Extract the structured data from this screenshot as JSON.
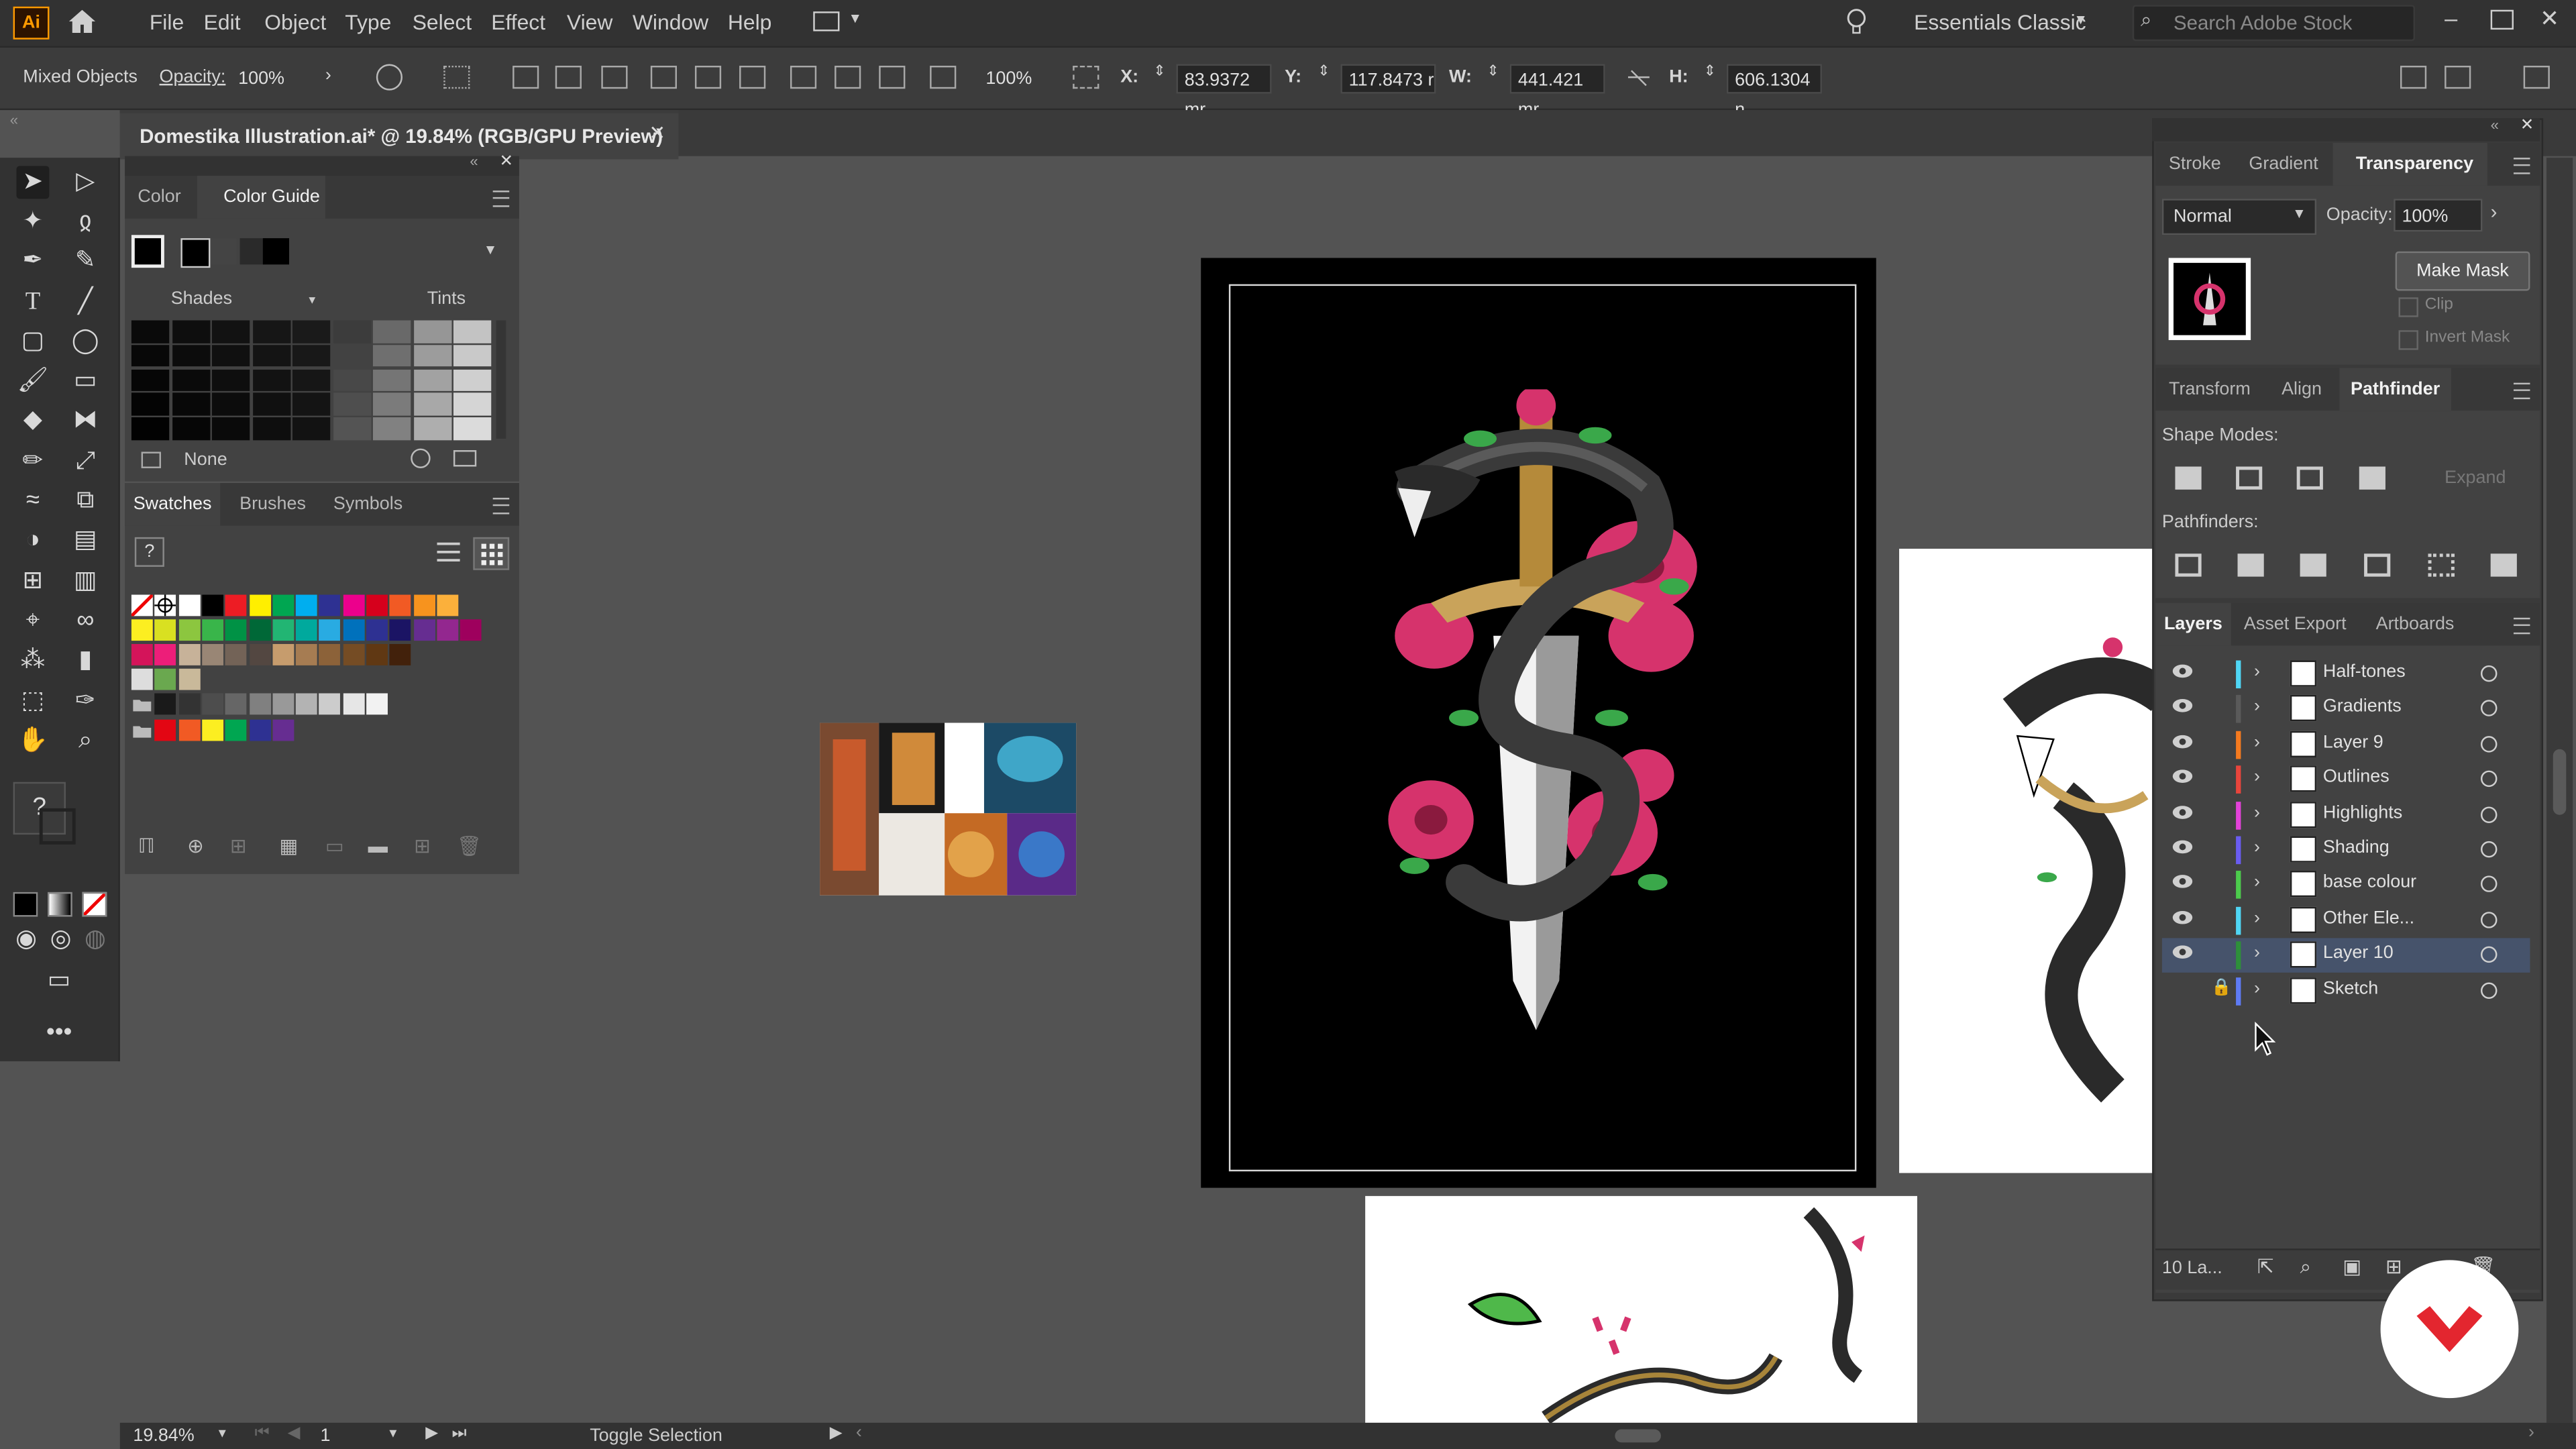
{
  "menubar": {
    "logo": "Ai",
    "items": [
      "File",
      "Edit",
      "Object",
      "Type",
      "Select",
      "Effect",
      "View",
      "Window",
      "Help"
    ],
    "workspace": "Essentials Classic",
    "search_placeholder": "Search Adobe Stock"
  },
  "controlbar": {
    "selection": "Mixed Objects",
    "opacity_label": "Opacity:",
    "opacity_value": "100%",
    "zoom_field": "100%",
    "x_label": "X:",
    "x_value": "83.9372 mr",
    "y_label": "Y:",
    "y_value": "117.8473 r",
    "w_label": "W:",
    "w_value": "441.421 mr",
    "h_label": "H:",
    "h_value": "606.1304 n"
  },
  "document": {
    "tab_title": "Domestika Illustration.ai* @ 19.84% (RGB/GPU Preview)"
  },
  "color_panel": {
    "tabs": [
      "Color",
      "Color Guide"
    ],
    "shades_label": "Shades",
    "tints_label": "Tints",
    "none_label": "None"
  },
  "swatches_panel": {
    "tabs": [
      "Swatches",
      "Brushes",
      "Symbols"
    ],
    "row1": [
      "#ffffff",
      "#000000",
      "#ed1c24",
      "#ffef00",
      "#00a651",
      "#00aeef",
      "#2e3192",
      "#ec008c",
      "#d6001c",
      "#f15a24",
      "#f7931e",
      "#fbb03b"
    ],
    "row2": [
      "#fcee21",
      "#d9e021",
      "#8cc63f",
      "#39b54a",
      "#009245",
      "#006837",
      "#22b573",
      "#00a99d",
      "#29abe2",
      "#0071bc",
      "#2e3192",
      "#1b1464",
      "#662d91",
      "#93278f",
      "#9e005d"
    ],
    "row3": [
      "#d4145a",
      "#ed1e79",
      "#c7b299",
      "#998675",
      "#736357",
      "#534741",
      "#c69c6d",
      "#a67c52",
      "#8c6239",
      "#754c24",
      "#603813",
      "#42210b"
    ],
    "row4": [
      "#1a1a1a",
      "#333333",
      "#4d4d4d",
      "#666666",
      "#808080",
      "#999999",
      "#b3b3b3",
      "#cccccc",
      "#e6e6e6",
      "#f2f2f2"
    ],
    "row5": [
      "#e30613",
      "#f15a24",
      "#fcee21",
      "#00a651",
      "#2e3192",
      "#662d91"
    ]
  },
  "transparency_panel": {
    "tabs": [
      "Stroke",
      "Gradient",
      "Transparency"
    ],
    "blend_mode": "Normal",
    "opacity_label": "Opacity:",
    "opacity_value": "100%",
    "make_mask": "Make Mask",
    "clip": "Clip",
    "invert_mask": "Invert Mask"
  },
  "pathfinder_panel": {
    "tabs": [
      "Transform",
      "Align",
      "Pathfinder"
    ],
    "shape_modes": "Shape Modes:",
    "pathfinders": "Pathfinders:",
    "expand": "Expand"
  },
  "layers_panel": {
    "tabs": [
      "Layers",
      "Asset Export",
      "Artboards"
    ],
    "layers": [
      {
        "name": "Half-tones",
        "color": "#4fd6f5"
      },
      {
        "name": "Gradients",
        "color": "#5a5a5a"
      },
      {
        "name": "Layer 9",
        "color": "#f47a1f"
      },
      {
        "name": "Outlines",
        "color": "#e8453c"
      },
      {
        "name": "Highlights",
        "color": "#e342d9"
      },
      {
        "name": "Shading",
        "color": "#6a5cf0"
      },
      {
        "name": "base colour",
        "color": "#4ccb4c"
      },
      {
        "name": "Other Ele...",
        "color": "#4fd6f5"
      },
      {
        "name": "Layer 10",
        "color": "#2e8f3a"
      },
      {
        "name": "Sketch",
        "color": "#5e7bf5"
      }
    ],
    "count_label": "10 La..."
  },
  "statusbar": {
    "zoom": "19.84%",
    "artboard_num": "1",
    "status_text": "Toggle Selection"
  }
}
